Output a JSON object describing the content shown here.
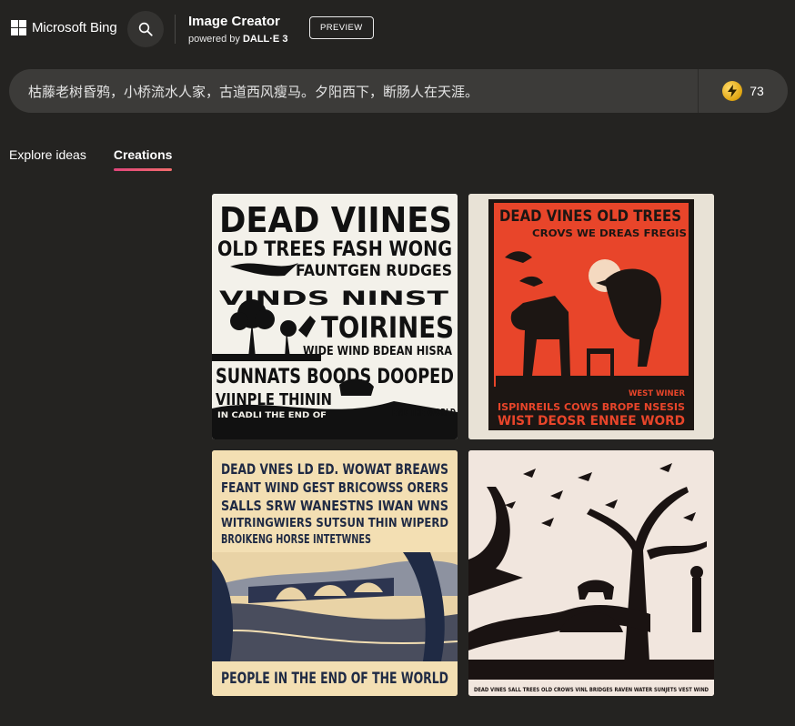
{
  "header": {
    "brand": "Microsoft Bing",
    "product_title": "Image Creator",
    "product_sub_prefix": "powered by ",
    "product_sub_model": "DALL·E 3",
    "preview_label": "PREVIEW",
    "icons": {
      "logo": "microsoft-logo",
      "search": "search-icon"
    }
  },
  "prompt": {
    "text": "枯藤老树昏鸦，小桥流水人家，古道西风瘦马。夕阳西下，断肠人在天涯。",
    "boosts": "73",
    "boost_icon": "boost-coin-icon"
  },
  "tabs": [
    {
      "label": "Explore ideas",
      "active": false
    },
    {
      "label": "Creations",
      "active": true
    }
  ],
  "images": [
    {
      "lines": [
        "DEAD VIINES",
        "OLD TREES FASH WONG",
        "FAUNTGEN RUDGES",
        "VINDS NINST",
        "TOIRINES",
        "WIDE WIND BDEAN HISRA",
        "SUNNATS BOODS DOOPED",
        "VIINPLE THININ",
        "IN CADLI THE END OF",
        "END THE WORLD"
      ]
    },
    {
      "lines": [
        "DEAD VINES OLD TREES",
        "CROVS WE DREAS FREGIS",
        "ISPINREILS COWS BROPE NSESIS",
        "WIST DEOSR ENNEE WORD",
        "WEST WINER"
      ]
    },
    {
      "lines": [
        "DEAD VNES LD ED. WOWAT BREAWS",
        "FEANT WIND GEST BRICOWSS ORERS",
        "SALLS SRW WANESTNS IWAN WNS",
        "WITRINGWIERS SUTSUN THIN WIPERD",
        "BROIKENG HORSE INTETWNES",
        "PEOPLE IN THE END OF THE WORLD"
      ]
    },
    {
      "lines": [
        "DEAD VINES   SALL TREES   OLD CROWS   VINL BRIDGES   RAVEN WATER   SUNJETS   VEST WIND"
      ]
    }
  ],
  "colors": {
    "background": "#242321",
    "prompt_bar": "#3c3b39",
    "tab_underline": "#e0457b",
    "card2_red": "#e8452a",
    "card3_ink": "#1f2a44"
  }
}
